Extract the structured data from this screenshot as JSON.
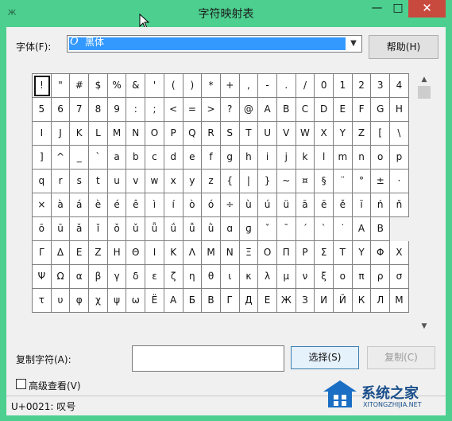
{
  "window": {
    "title": "字符映射表",
    "minimize_symbol": "—",
    "maximize_symbol": "□",
    "close_symbol": "✕"
  },
  "font": {
    "label": "字体(F):",
    "selected": "黑体",
    "help_label": "帮助(H)"
  },
  "characters": [
    [
      "!",
      "\"",
      "#",
      "$",
      "%",
      "&",
      "'",
      "(",
      ")",
      "*",
      "+",
      ",",
      "-",
      ".",
      "/",
      "0",
      "1",
      "2",
      "3",
      "4"
    ],
    [
      "5",
      "6",
      "7",
      "8",
      "9",
      ":",
      ";",
      "<",
      "=",
      ">",
      "?",
      "@",
      "A",
      "B",
      "C",
      "D",
      "E",
      "F",
      "G",
      "H"
    ],
    [
      "I",
      "J",
      "K",
      "L",
      "M",
      "N",
      "O",
      "P",
      "Q",
      "R",
      "S",
      "T",
      "U",
      "V",
      "W",
      "X",
      "Y",
      "Z",
      "[",
      "\\"
    ],
    [
      "]",
      "^",
      "_",
      "`",
      "a",
      "b",
      "c",
      "d",
      "e",
      "f",
      "g",
      "h",
      "i",
      "j",
      "k",
      "l",
      "m",
      "n",
      "o",
      "p"
    ],
    [
      "q",
      "r",
      "s",
      "t",
      "u",
      "v",
      "w",
      "x",
      "y",
      "z",
      "{",
      "|",
      "}",
      "~",
      "¤",
      "§",
      "¨",
      "°",
      "±",
      "·"
    ],
    [
      "×",
      "à",
      "á",
      "è",
      "é",
      "ê",
      "ì",
      "í",
      "ò",
      "ó",
      "÷",
      "ù",
      "ú",
      "ü",
      "ā",
      "ē",
      "ě",
      "ī",
      "ń",
      "ň"
    ],
    [
      "ō",
      "ū",
      "ǎ",
      "ǐ",
      "ǒ",
      "ǔ",
      "ǖ",
      "ǘ",
      "ǚ",
      "ǜ",
      "ɑ",
      "ɡ",
      "ˇ",
      "ˉ",
      "ˊ",
      "ˋ",
      "˙",
      "Α",
      "Β"
    ],
    [
      "Γ",
      "Δ",
      "Ε",
      "Ζ",
      "Η",
      "Θ",
      "Ι",
      "Κ",
      "Λ",
      "Μ",
      "Ν",
      "Ξ",
      "Ο",
      "Π",
      "Ρ",
      "Σ",
      "Τ",
      "Υ",
      "Φ",
      "Χ"
    ],
    [
      "Ψ",
      "Ω",
      "α",
      "β",
      "γ",
      "δ",
      "ε",
      "ζ",
      "η",
      "θ",
      "ι",
      "κ",
      "λ",
      "μ",
      "ν",
      "ξ",
      "ο",
      "π",
      "ρ",
      "σ"
    ],
    [
      "τ",
      "υ",
      "φ",
      "χ",
      "ψ",
      "ω",
      "Ё",
      "А",
      "Б",
      "В",
      "Г",
      "Д",
      "Е",
      "Ж",
      "З",
      "И",
      "Й",
      "К",
      "Л",
      "М"
    ]
  ],
  "copy": {
    "label": "复制字符(A):",
    "value": "",
    "select_label": "选择(S)",
    "copy_label": "复制(C)"
  },
  "advanced": {
    "label": "高级查看(V)",
    "checked": false
  },
  "status": {
    "text": "U+0021: 叹号"
  },
  "watermark": {
    "name": "系统之家",
    "url": "XITONGZHIJIA.NET"
  },
  "colors": {
    "titlebar": "#4ccf8f",
    "selection": "#3399ff",
    "close_button": "#c84a3f"
  }
}
